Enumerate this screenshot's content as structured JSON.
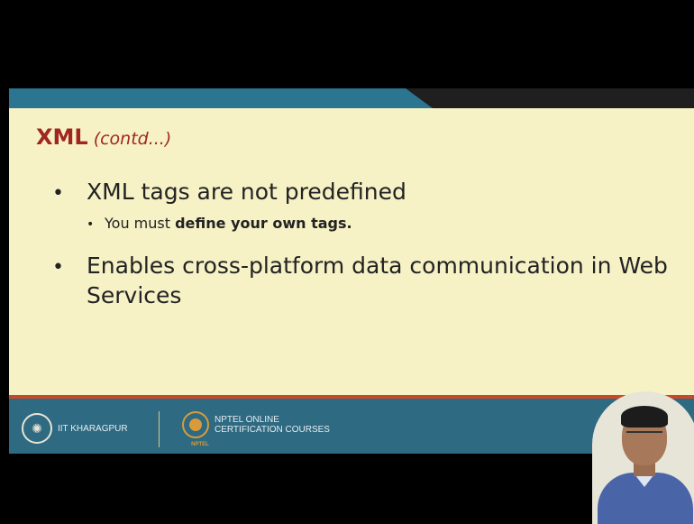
{
  "slide": {
    "title": "XML",
    "title_suffix": "(contd...)",
    "bullets": [
      {
        "text": "XML tags are not predefined",
        "sub": {
          "prefix": "You must ",
          "bold": "define your own tags."
        }
      },
      {
        "text": "Enables cross-platform data communication in Web Services"
      }
    ]
  },
  "footer": {
    "institute": "IIT KHARAGPUR",
    "nptel_line1": "NPTEL ONLINE",
    "nptel_line2": "CERTIFICATION COURSES",
    "nptel_logo_text": "NPTEL"
  },
  "colors": {
    "slide_bg": "#f6f2c6",
    "title": "#a0271f",
    "topbar_teal": "#2b7590",
    "footer_bg": "#2e6a82",
    "footer_line": "#c64a2a"
  },
  "icons": {
    "institute_logo": "iit-kharagpur-logo-icon",
    "nptel_logo": "nptel-logo-icon"
  }
}
